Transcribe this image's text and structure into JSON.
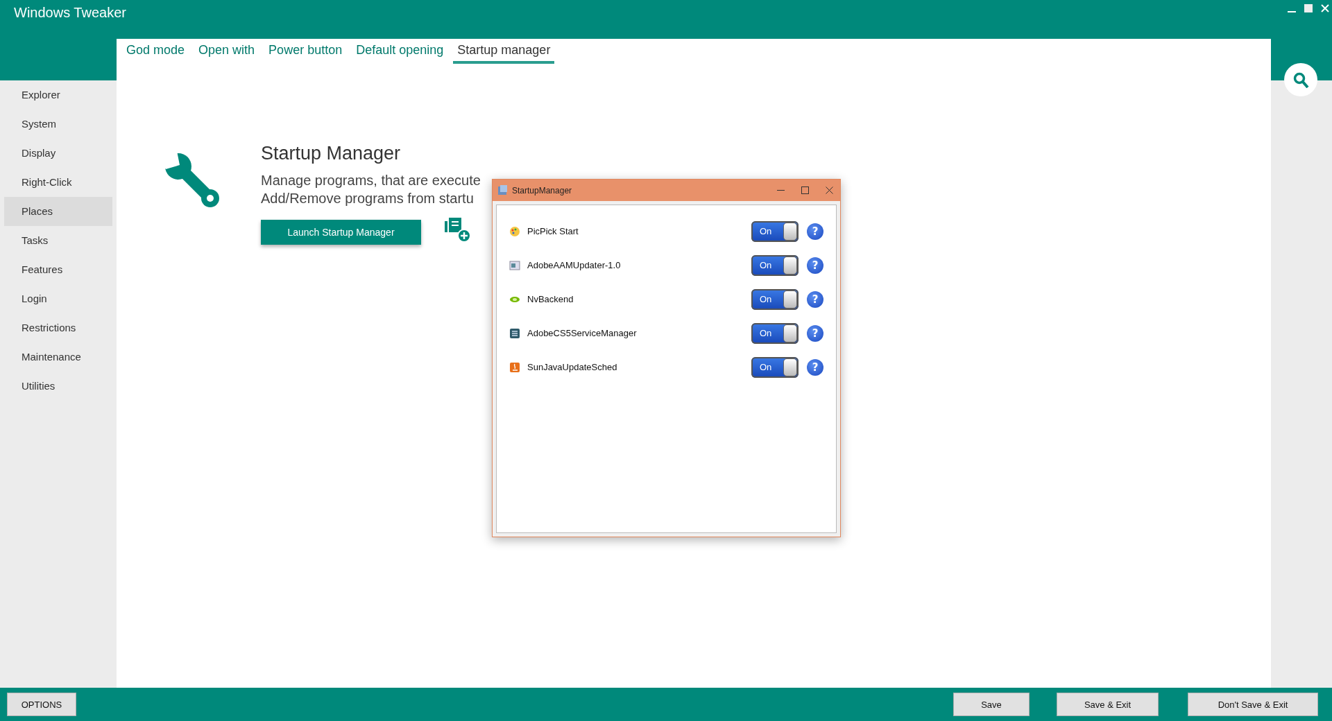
{
  "window": {
    "title": "Windows Tweaker"
  },
  "tabs": [
    {
      "label": "God mode",
      "selected": false
    },
    {
      "label": "Open with",
      "selected": false
    },
    {
      "label": "Power button",
      "selected": false
    },
    {
      "label": "Default opening",
      "selected": false
    },
    {
      "label": "Startup manager",
      "selected": true
    }
  ],
  "sidebar": {
    "items": [
      {
        "label": "Explorer",
        "selected": false
      },
      {
        "label": "System",
        "selected": false
      },
      {
        "label": "Display",
        "selected": false
      },
      {
        "label": "Right-Click",
        "selected": false
      },
      {
        "label": "Places",
        "selected": true
      },
      {
        "label": "Tasks",
        "selected": false
      },
      {
        "label": "Features",
        "selected": false
      },
      {
        "label": "Login",
        "selected": false
      },
      {
        "label": "Restrictions",
        "selected": false
      },
      {
        "label": "Maintenance",
        "selected": false
      },
      {
        "label": "Utilities",
        "selected": false
      }
    ]
  },
  "content": {
    "heading": "Startup Manager",
    "description": [
      "Manage programs, that are execute",
      "Add/Remove programs from startu"
    ],
    "launch_button": "Launch Startup Manager"
  },
  "dialog": {
    "title": "StartupManager",
    "programs": [
      {
        "name": "PicPick Start",
        "on": true,
        "toggle_label": "On",
        "help": "?"
      },
      {
        "name": "AdobeAAMUpdater-1.0",
        "on": true,
        "toggle_label": "On",
        "help": "?"
      },
      {
        "name": "NvBackend",
        "on": true,
        "toggle_label": "On",
        "help": "?"
      },
      {
        "name": "AdobeCS5ServiceManager",
        "on": true,
        "toggle_label": "On",
        "help": "?"
      },
      {
        "name": "SunJavaUpdateSched",
        "on": true,
        "toggle_label": "On",
        "help": "?"
      }
    ]
  },
  "bottom_bar": {
    "left_buttons": [
      "OPTIONS"
    ],
    "right_buttons": [
      "Save",
      "Save & Exit",
      "Don't Save & Exit"
    ]
  }
}
